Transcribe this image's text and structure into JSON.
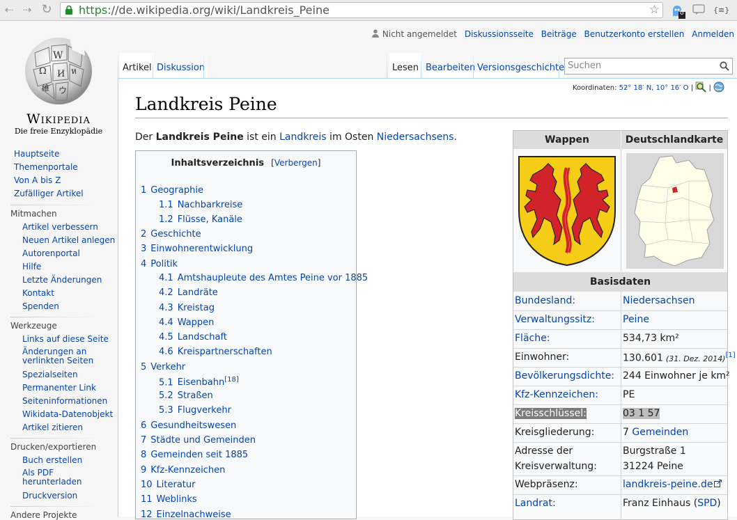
{
  "browser": {
    "url_scheme": "https",
    "url_rest": "://de.wikipedia.org/wiki/Landkreis_Peine",
    "ext_badge": "0",
    "ext_label": "{≡}"
  },
  "logo": {
    "wordmark": "Wikipedia",
    "tagline": "Die freie Enzyklopädie"
  },
  "personal": {
    "not_logged_in": "Nicht angemeldet",
    "talk": "Diskussionsseite",
    "contributions": "Beiträge",
    "create_account": "Benutzerkonto erstellen",
    "login": "Anmelden"
  },
  "tabs": {
    "article": "Artikel",
    "talk": "Diskussion",
    "read": "Lesen",
    "edit": "Bearbeiten",
    "history": "Versionsgeschichte"
  },
  "search": {
    "placeholder": "Suchen"
  },
  "sidebar": {
    "main": [
      "Hauptseite",
      "Themenportale",
      "Von A bis Z",
      "Zufälliger Artikel"
    ],
    "participate_heading": "Mitmachen",
    "participate": [
      "Artikel verbessern",
      "Neuen Artikel anlegen",
      "Autorenportal",
      "Hilfe",
      "Letzte Änderungen",
      "Kontakt",
      "Spenden"
    ],
    "tools_heading": "Werkzeuge",
    "tools": [
      "Links auf diese Seite",
      "Änderungen an",
      "verlinkten Seiten",
      "Spezialseiten",
      "Permanenter Link",
      "Seiteninformationen",
      "Wikidata-Datenobjekt",
      "Artikel zitieren"
    ],
    "print_heading": "Drucken/exportieren",
    "print": [
      "Buch erstellen",
      "Als PDF",
      "herunterladen",
      "Druckversion"
    ],
    "other_heading": "Andere Projekte"
  },
  "coordinates": {
    "label": "Koordinaten:",
    "value": "52° 18′ N, 10° 16′ O"
  },
  "article": {
    "title": "Landkreis Peine",
    "lead_1": "Der ",
    "lead_bold": "Landkreis Peine",
    "lead_2": " ist ein ",
    "lead_link1": "Landkreis",
    "lead_3": " im Osten ",
    "lead_link2": "Niedersachsens",
    "lead_4": "."
  },
  "toc": {
    "title": "Inhaltsverzeichnis",
    "toggle": "Verbergen",
    "items": [
      {
        "num": "1",
        "text": "Geographie"
      },
      {
        "num": "1.1",
        "text": "Nachbarkreise"
      },
      {
        "num": "1.2",
        "text": "Flüsse, Kanäle"
      },
      {
        "num": "2",
        "text": "Geschichte"
      },
      {
        "num": "3",
        "text": "Einwohnerentwicklung"
      },
      {
        "num": "4",
        "text": "Politik"
      },
      {
        "num": "4.1",
        "text": "Amtshaupleute des Amtes Peine vor 1885"
      },
      {
        "num": "4.2",
        "text": "Landräte"
      },
      {
        "num": "4.3",
        "text": "Kreistag"
      },
      {
        "num": "4.4",
        "text": "Wappen"
      },
      {
        "num": "4.5",
        "text": "Landschaft"
      },
      {
        "num": "4.6",
        "text": "Kreispartnerschaften"
      },
      {
        "num": "5",
        "text": "Verkehr"
      },
      {
        "num": "5.1",
        "text": "Eisenbahn",
        "sup": "[18]"
      },
      {
        "num": "5.2",
        "text": "Straßen"
      },
      {
        "num": "5.3",
        "text": "Flugverkehr"
      },
      {
        "num": "6",
        "text": "Gesundheitswesen"
      },
      {
        "num": "7",
        "text": "Städte und Gemeinden"
      },
      {
        "num": "8",
        "text": "Gemeinden seit 1885"
      },
      {
        "num": "9",
        "text": "Kfz-Kennzeichen"
      },
      {
        "num": "10",
        "text": "Literatur"
      },
      {
        "num": "11",
        "text": "Weblinks"
      },
      {
        "num": "12",
        "text": "Einzelnachweise"
      }
    ]
  },
  "infobox": {
    "col1": "Wappen",
    "col2": "Deutschlandkarte",
    "basisdaten": "Basisdaten",
    "rows": [
      {
        "label": "Bundesland:",
        "value": "Niedersachsen"
      },
      {
        "label": "Verwaltungssitz:",
        "value": "Peine"
      },
      {
        "label": "Fläche:",
        "value": "534,73 km²"
      },
      {
        "label": "Einwohner:",
        "value": "130.601",
        "note": "(31. Dez. 2014)",
        "ref": "[1]"
      },
      {
        "label": "Bevölkerungsdichte:",
        "value": "244 Einwohner je km²"
      },
      {
        "label": "Kfz-Kennzeichen:",
        "value": "PE"
      },
      {
        "label": "Kreisschlüssel:",
        "value": "03 1 57"
      },
      {
        "label": "Kreisgliederung:",
        "value_num": "7 ",
        "value": "Gemeinden"
      },
      {
        "label": "Adresse der",
        "label2": "Kreisverwaltung:",
        "value": "Burgstraße 1",
        "value2": "31224 Peine"
      },
      {
        "label": "Webpräsenz:",
        "value": "landkreis-peine.de"
      },
      {
        "label": "Landrat:",
        "value": "Franz Einhaus (",
        "value_link": "SPD",
        "value_end": ")"
      }
    ]
  },
  "colors": {
    "link": "#0645ad",
    "tab_border": "#a7d7f9",
    "shield_yellow": "#f5cc16",
    "lion_red": "#d2232a"
  }
}
